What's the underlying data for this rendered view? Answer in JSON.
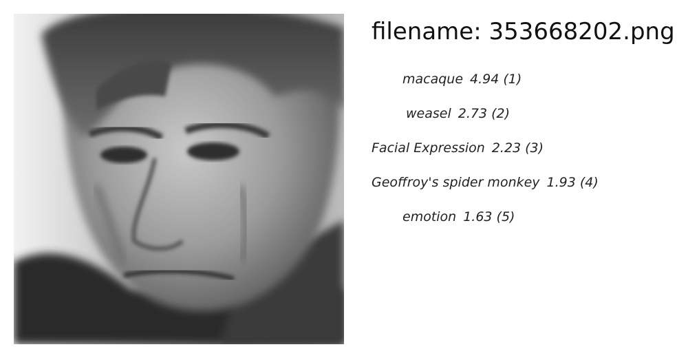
{
  "filename_label": "filename: 353668202.png",
  "photo": {
    "alt": "grayscale portrait of a man"
  },
  "predictions": [
    {
      "label": "macaque",
      "score": "4.94",
      "rank": "(1)"
    },
    {
      "label": "weasel",
      "score": "2.73",
      "rank": "(2)"
    },
    {
      "label": "Facial Expression",
      "score": "2.23",
      "rank": "(3)"
    },
    {
      "label": "Geoffroy's spider monkey",
      "score": "1.93",
      "rank": "(4)"
    },
    {
      "label": "emotion",
      "score": "1.63",
      "rank": "(5)"
    }
  ]
}
